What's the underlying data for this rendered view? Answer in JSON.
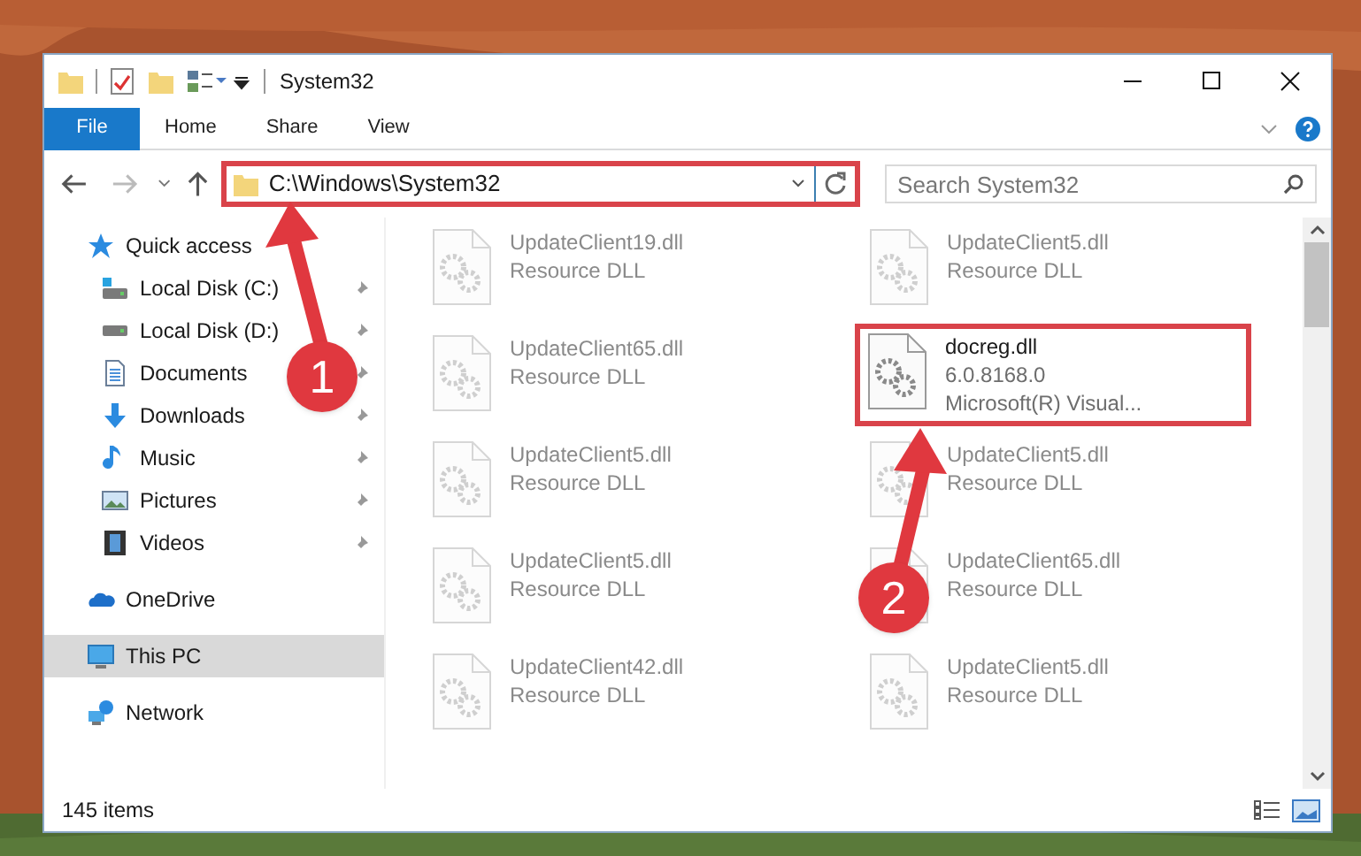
{
  "window": {
    "title": "System32"
  },
  "ribbon": {
    "tabs": [
      {
        "label": "File",
        "kind": "file"
      },
      {
        "label": "Home",
        "kind": "tab"
      },
      {
        "label": "Share",
        "kind": "tab"
      },
      {
        "label": "View",
        "kind": "tab"
      }
    ]
  },
  "address": {
    "path": "C:\\Windows\\System32",
    "highlighted": true
  },
  "search": {
    "placeholder": "Search System32"
  },
  "sidebar": {
    "items": [
      {
        "label": "Quick access",
        "kind": "star",
        "pinned": false,
        "selected": false
      },
      {
        "label": "Local Disk (C:)",
        "kind": "drive-c",
        "pinned": true,
        "selected": false
      },
      {
        "label": "Local Disk (D:)",
        "kind": "drive",
        "pinned": true,
        "selected": false
      },
      {
        "label": "Documents",
        "kind": "documents",
        "pinned": true,
        "selected": false
      },
      {
        "label": "Downloads",
        "kind": "downloads",
        "pinned": true,
        "selected": false
      },
      {
        "label": "Music",
        "kind": "music",
        "pinned": true,
        "selected": false
      },
      {
        "label": "Pictures",
        "kind": "pictures",
        "pinned": true,
        "selected": false
      },
      {
        "label": "Videos",
        "kind": "videos",
        "pinned": true,
        "selected": false
      },
      {
        "label": "OneDrive",
        "kind": "cloud",
        "pinned": false,
        "selected": false
      },
      {
        "label": "This PC",
        "kind": "pc",
        "pinned": false,
        "selected": true
      },
      {
        "label": "Network",
        "kind": "network",
        "pinned": false,
        "selected": false
      }
    ]
  },
  "files": [
    {
      "name": "UpdateClient19.dll",
      "detail": "Resource DLL",
      "blurred": true,
      "highlighted": false
    },
    {
      "name": "UpdateClient5.dll",
      "detail": "Resource DLL",
      "blurred": true,
      "highlighted": false
    },
    {
      "name": "UpdateClient65.dll",
      "detail": "Resource DLL",
      "blurred": true,
      "highlighted": false
    },
    {
      "name": "docreg.dll",
      "version": "6.0.8168.0",
      "detail": "Microsoft(R) Visual...",
      "blurred": false,
      "highlighted": true
    },
    {
      "name": "UpdateClient5.dll",
      "detail": "Resource DLL",
      "blurred": true,
      "highlighted": false
    },
    {
      "name": "UpdateClient5.dll",
      "detail": "Resource DLL",
      "blurred": true,
      "highlighted": false
    },
    {
      "name": "UpdateClient5.dll",
      "detail": "Resource DLL",
      "blurred": true,
      "highlighted": false
    },
    {
      "name": "UpdateClient65.dll",
      "detail": "Resource DLL",
      "blurred": true,
      "highlighted": false
    },
    {
      "name": "UpdateClient42.dll",
      "detail": "Resource DLL",
      "blurred": true,
      "highlighted": false
    },
    {
      "name": "UpdateClient5.dll",
      "detail": "Resource DLL",
      "blurred": true,
      "highlighted": false
    }
  ],
  "status_bar": {
    "count": "145 items"
  },
  "annotations": [
    {
      "label": "1"
    },
    {
      "label": "2"
    }
  ]
}
